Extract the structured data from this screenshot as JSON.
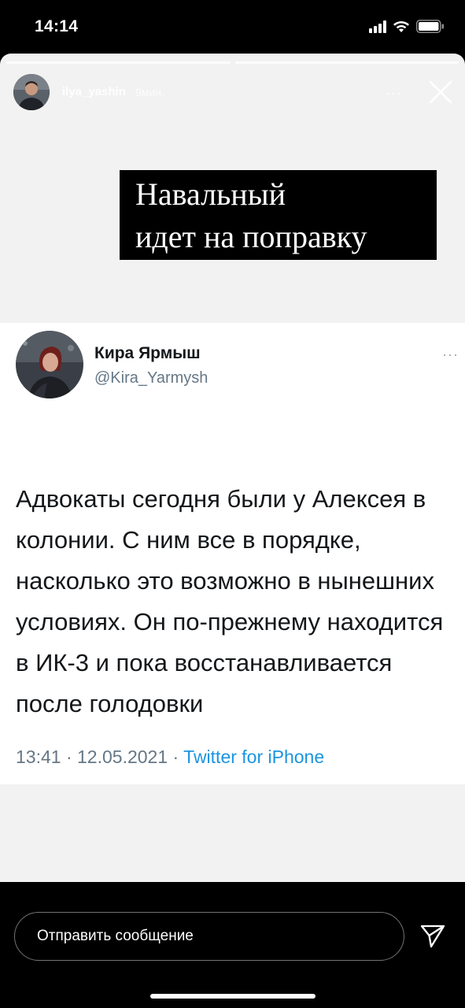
{
  "status_bar": {
    "time": "14:14"
  },
  "story": {
    "progress_segments": 2,
    "username": "ilya_yashin",
    "posted_ago": "9мин.",
    "more_label": "···",
    "caption_line1": "Навальный",
    "caption_line2": "идет на поправку"
  },
  "tweet": {
    "author_name": "Кира Ярмыш",
    "author_handle": "@Kira_Yarmysh",
    "more_label": "···",
    "text": "Адвокаты сегодня были у Алексея в колонии. С ним все в порядке, насколько это возможно в нынешних условиях. Он по-прежнему находится в ИК-3 и пока восстанавливается после голодовки",
    "time": "13:41",
    "date": "12.05.2021",
    "separator": " · ",
    "source": "Twitter for iPhone"
  },
  "reply": {
    "placeholder": "Отправить сообщение"
  },
  "colors": {
    "tweet_link": "#1b95e0",
    "tweet_secondary": "#657786",
    "story_background": "#f2f2f2"
  },
  "icons": {
    "close": "close-icon",
    "send": "send-icon",
    "signal": "signal-icon",
    "wifi": "wifi-icon",
    "battery": "battery-icon"
  }
}
